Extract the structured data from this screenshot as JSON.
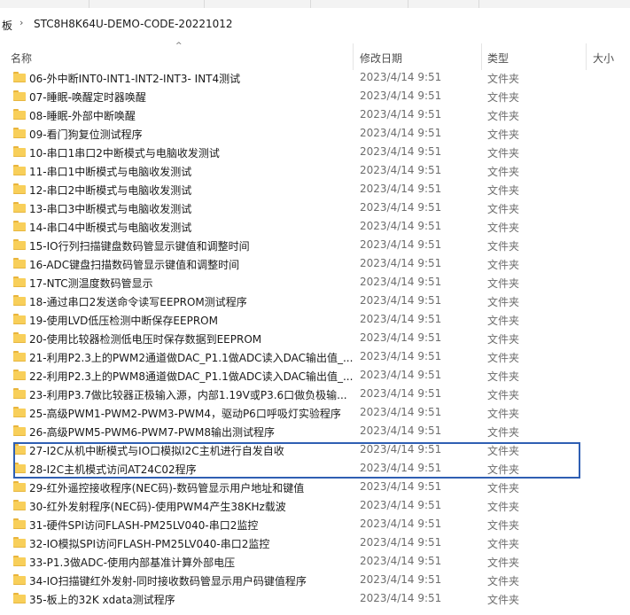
{
  "breadcrumb": {
    "prev": "板",
    "current": "STC8H8K64U-DEMO-CODE-20221012"
  },
  "columns": {
    "name": "名称",
    "modified": "修改日期",
    "type": "类型",
    "size": "大小"
  },
  "files": [
    {
      "name": "06-外中断INT0-INT1-INT2-INT3- INT4测试",
      "date": "2023/4/14 9:51",
      "type": "文件夹"
    },
    {
      "name": "07-睡眠-唤醒定时器唤醒",
      "date": "2023/4/14 9:51",
      "type": "文件夹"
    },
    {
      "name": "08-睡眠-外部中断唤醒",
      "date": "2023/4/14 9:51",
      "type": "文件夹"
    },
    {
      "name": "09-看门狗复位测试程序",
      "date": "2023/4/14 9:51",
      "type": "文件夹"
    },
    {
      "name": "10-串口1串口2中断模式与电脑收发测试",
      "date": "2023/4/14 9:51",
      "type": "文件夹"
    },
    {
      "name": "11-串口1中断模式与电脑收发测试",
      "date": "2023/4/14 9:51",
      "type": "文件夹"
    },
    {
      "name": "12-串口2中断模式与电脑收发测试",
      "date": "2023/4/14 9:51",
      "type": "文件夹"
    },
    {
      "name": "13-串口3中断模式与电脑收发测试",
      "date": "2023/4/14 9:51",
      "type": "文件夹"
    },
    {
      "name": "14-串口4中断模式与电脑收发测试",
      "date": "2023/4/14 9:51",
      "type": "文件夹"
    },
    {
      "name": "15-IO行列扫描键盘数码管显示键值和调整时间",
      "date": "2023/4/14 9:51",
      "type": "文件夹"
    },
    {
      "name": "16-ADC键盘扫描数码管显示键值和调整时间",
      "date": "2023/4/14 9:51",
      "type": "文件夹"
    },
    {
      "name": "17-NTC测温度数码管显示",
      "date": "2023/4/14 9:51",
      "type": "文件夹"
    },
    {
      "name": "18-通过串口2发送命令读写EEPROM测试程序",
      "date": "2023/4/14 9:51",
      "type": "文件夹"
    },
    {
      "name": "19-使用LVD低压检测中断保存EEPROM",
      "date": "2023/4/14 9:51",
      "type": "文件夹"
    },
    {
      "name": "20-使用比较器检测低电压时保存数据到EEPROM",
      "date": "2023/4/14 9:51",
      "type": "文件夹"
    },
    {
      "name": "21-利用P2.3上的PWM2通道做DAC_P1.1做ADC读入DAC输出值_...",
      "date": "2023/4/14 9:51",
      "type": "文件夹"
    },
    {
      "name": "22-利用P2.3上的PWM8通道做DAC_P1.1做ADC读入DAC输出值_...",
      "date": "2023/4/14 9:51",
      "type": "文件夹"
    },
    {
      "name": "23-利用P3.7做比较器正极输入源，内部1.19V或P3.6口做负极输...",
      "date": "2023/4/14 9:51",
      "type": "文件夹"
    },
    {
      "name": "25-高级PWM1-PWM2-PWM3-PWM4，驱动P6口呼吸灯实验程序",
      "date": "2023/4/14 9:51",
      "type": "文件夹"
    },
    {
      "name": "26-高级PWM5-PWM6-PWM7-PWM8输出测试程序",
      "date": "2023/4/14 9:51",
      "type": "文件夹"
    },
    {
      "name": "27-I2C从机中断模式与IO口模拟I2C主机进行自发自收",
      "date": "2023/4/14 9:51",
      "type": "文件夹"
    },
    {
      "name": "28-I2C主机模式访问AT24C02程序",
      "date": "2023/4/14 9:51",
      "type": "文件夹"
    },
    {
      "name": "29-红外遥控接收程序(NEC码)-数码管显示用户地址和键值",
      "date": "2023/4/14 9:51",
      "type": "文件夹"
    },
    {
      "name": "30-红外发射程序(NEC码)-使用PWM4产生38KHz载波",
      "date": "2023/4/14 9:51",
      "type": "文件夹"
    },
    {
      "name": "31-硬件SPI访问FLASH-PM25LV040-串口2监控",
      "date": "2023/4/14 9:51",
      "type": "文件夹"
    },
    {
      "name": "32-IO模拟SPI访问FLASH-PM25LV040-串口2监控",
      "date": "2023/4/14 9:51",
      "type": "文件夹"
    },
    {
      "name": "33-P1.3做ADC-使用内部基准计算外部电压",
      "date": "2023/4/14 9:51",
      "type": "文件夹"
    },
    {
      "name": "34-IO扫描键红外发射-同时接收数码管显示用户码键值程序",
      "date": "2023/4/14 9:51",
      "type": "文件夹"
    },
    {
      "name": "35-板上的32K xdata测试程序",
      "date": "2023/4/14 9:51",
      "type": "文件夹"
    }
  ]
}
